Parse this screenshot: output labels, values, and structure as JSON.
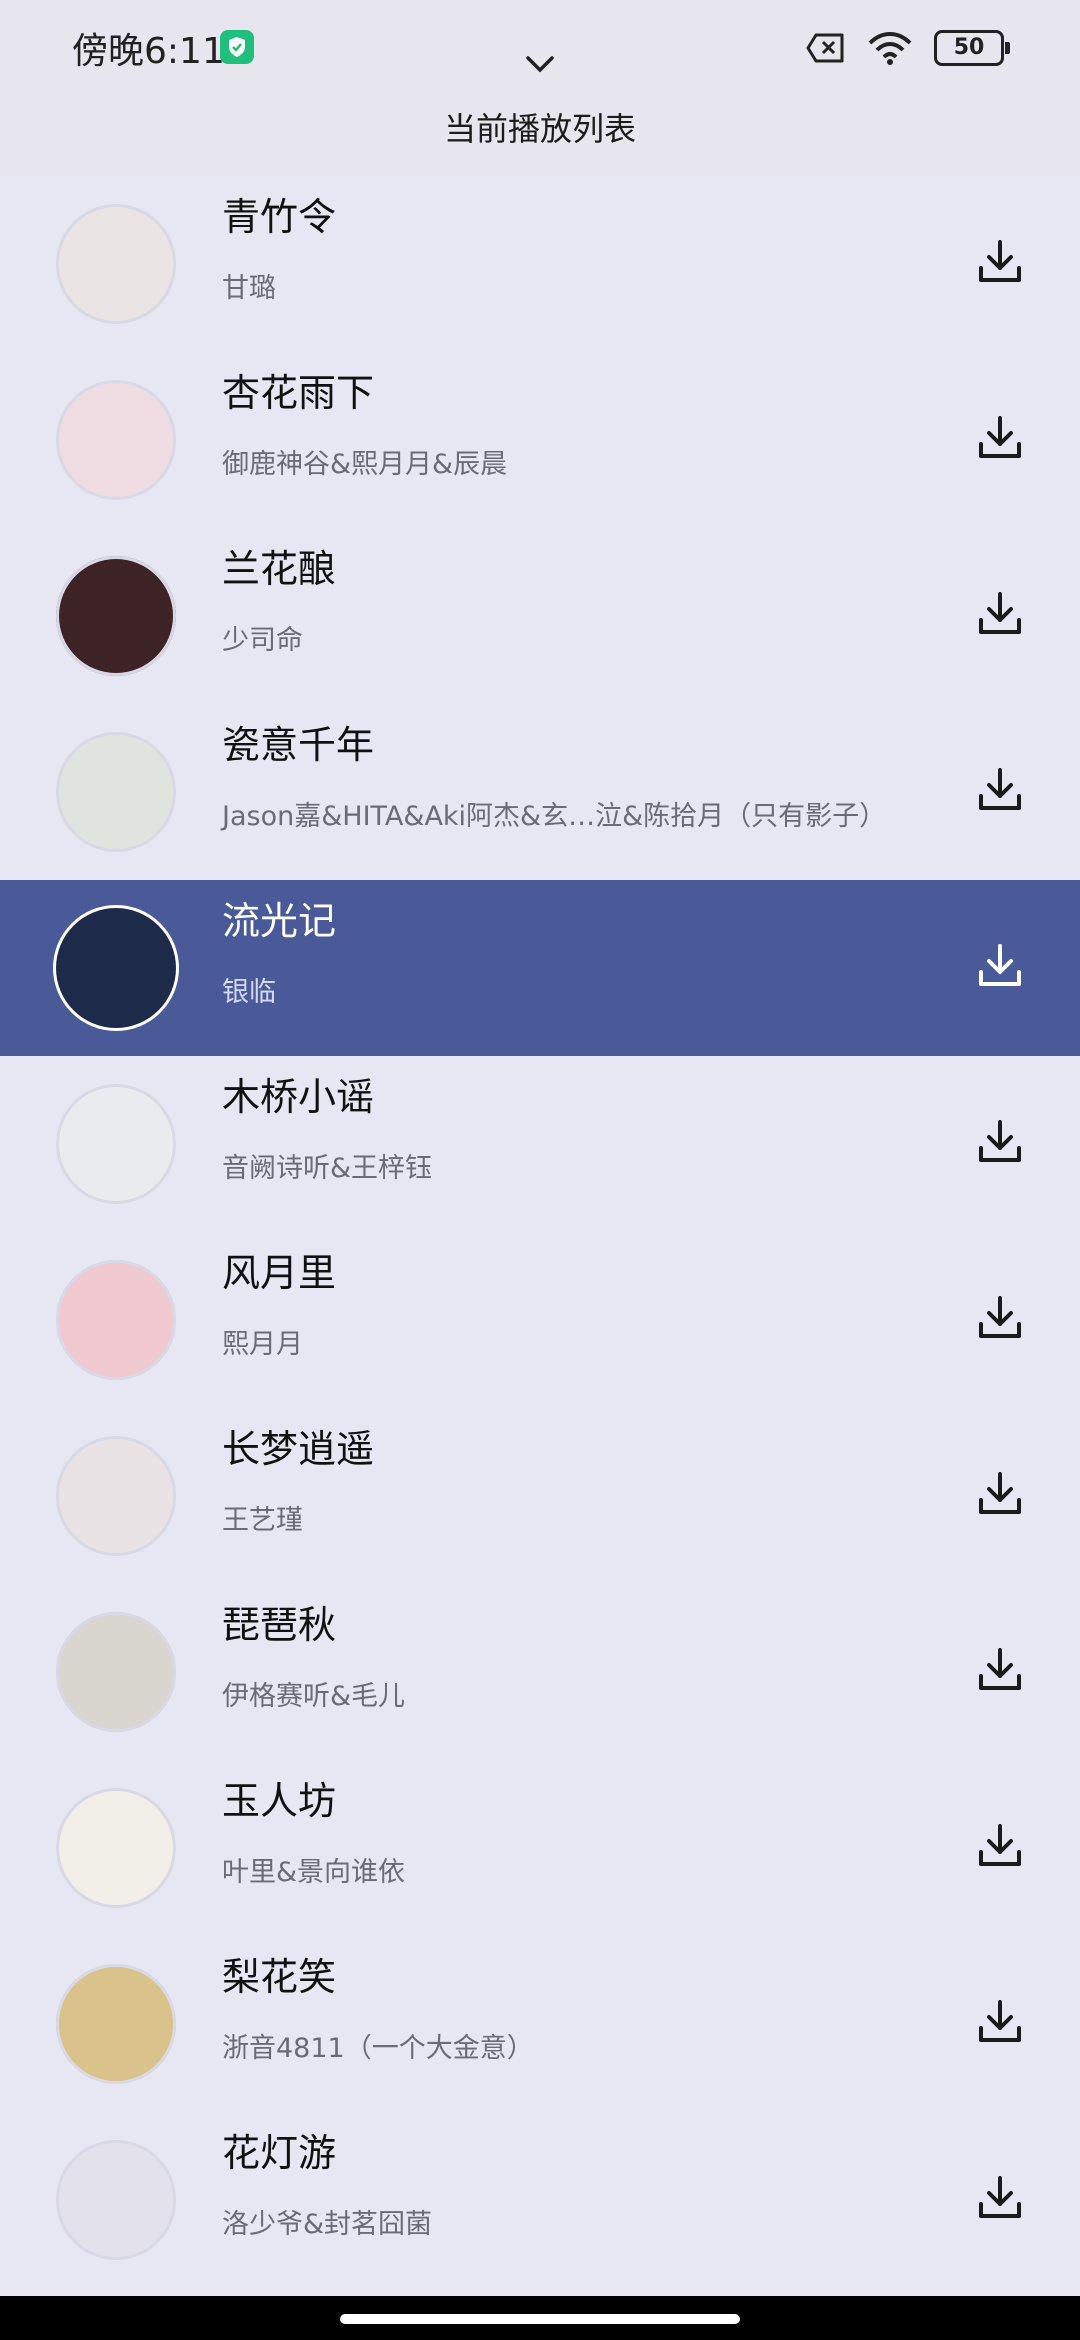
{
  "status_bar": {
    "time": "傍晚6:11",
    "battery": "50"
  },
  "header": {
    "title": "当前播放列表"
  },
  "songs": [
    {
      "title": "青竹令",
      "artist": "甘璐",
      "cover": "#eae4e4"
    },
    {
      "title": "杏花雨下",
      "artist": "御鹿神谷&熙月月&辰晨",
      "cover": "#efdde3"
    },
    {
      "title": "兰花酿",
      "artist": "少司命",
      "cover": "#3d2226"
    },
    {
      "title": "瓷意千年",
      "artist": "Jason嘉&HITA&Aki阿杰&玄…泣&陈拾月（只有影子）",
      "cover": "#dfe4df"
    },
    {
      "title": "流光记",
      "artist": "银临",
      "cover": "#1d2a4a"
    },
    {
      "title": "木桥小谣",
      "artist": "音阙诗听&王梓钰",
      "cover": "#e9ebef"
    },
    {
      "title": "风月里",
      "artist": "熙月月",
      "cover": "#f0c8cf"
    },
    {
      "title": "长梦逍遥",
      "artist": "王艺瑾",
      "cover": "#e9e3e6"
    },
    {
      "title": "琵琶秋",
      "artist": "伊格赛听&毛儿",
      "cover": "#d8d6cf"
    },
    {
      "title": "玉人坊",
      "artist": "叶里&景向谁依",
      "cover": "#f2efe8"
    },
    {
      "title": "梨花笑",
      "artist": "浙音4811（一个大金意）",
      "cover": "#d9c38a"
    },
    {
      "title": "花灯游",
      "artist": "洛少爷&封茗囧菌",
      "cover": "#e3e1ec"
    }
  ],
  "active_index": 4,
  "colors": {
    "background": "#e6e7f2",
    "active_row": "#4a5a99"
  }
}
